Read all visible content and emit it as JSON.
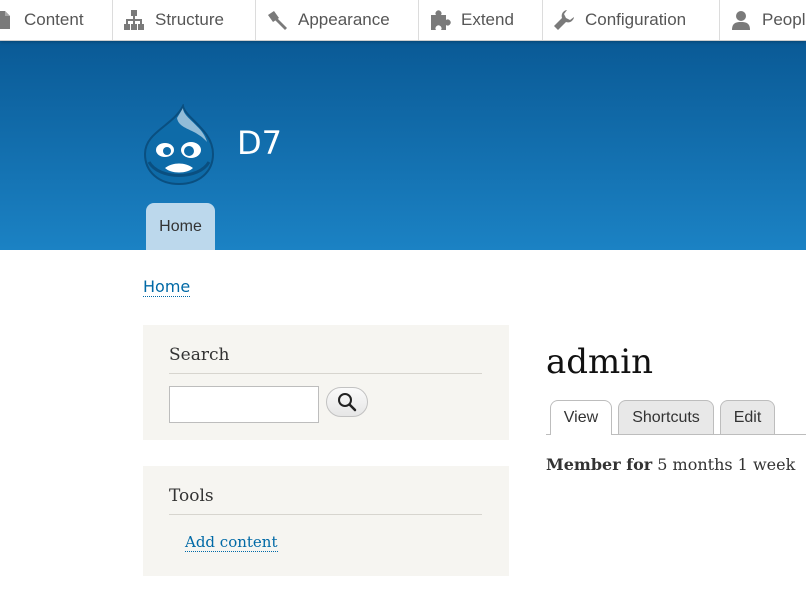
{
  "toolbar": {
    "items": [
      {
        "label": "Content",
        "icon": "page-icon"
      },
      {
        "label": "Structure",
        "icon": "sitemap-icon"
      },
      {
        "label": "Appearance",
        "icon": "paint-icon"
      },
      {
        "label": "Extend",
        "icon": "puzzle-icon"
      },
      {
        "label": "Configuration",
        "icon": "wrench-icon"
      },
      {
        "label": "People",
        "icon": "person-icon"
      }
    ]
  },
  "header": {
    "site_name": "D7",
    "logo": "drupal-drop-logo",
    "nav": {
      "home_label": "Home"
    }
  },
  "breadcrumb": {
    "home": "Home"
  },
  "sidebar": {
    "search": {
      "title": "Search",
      "input_value": "",
      "button_icon": "magnifier-icon"
    },
    "tools": {
      "title": "Tools",
      "links": [
        "Add content"
      ]
    }
  },
  "main": {
    "title": "admin",
    "tabs": [
      "View",
      "Shortcuts",
      "Edit"
    ],
    "active_tab": "View",
    "member_label": "Member for",
    "member_value": "5 months 1 week"
  },
  "colors": {
    "header_top": "#0a5a96",
    "header_bottom": "#1b82c4",
    "link": "#0069a6",
    "block_bg": "#f6f5f1",
    "nav_tab": "#bcd8ec"
  }
}
